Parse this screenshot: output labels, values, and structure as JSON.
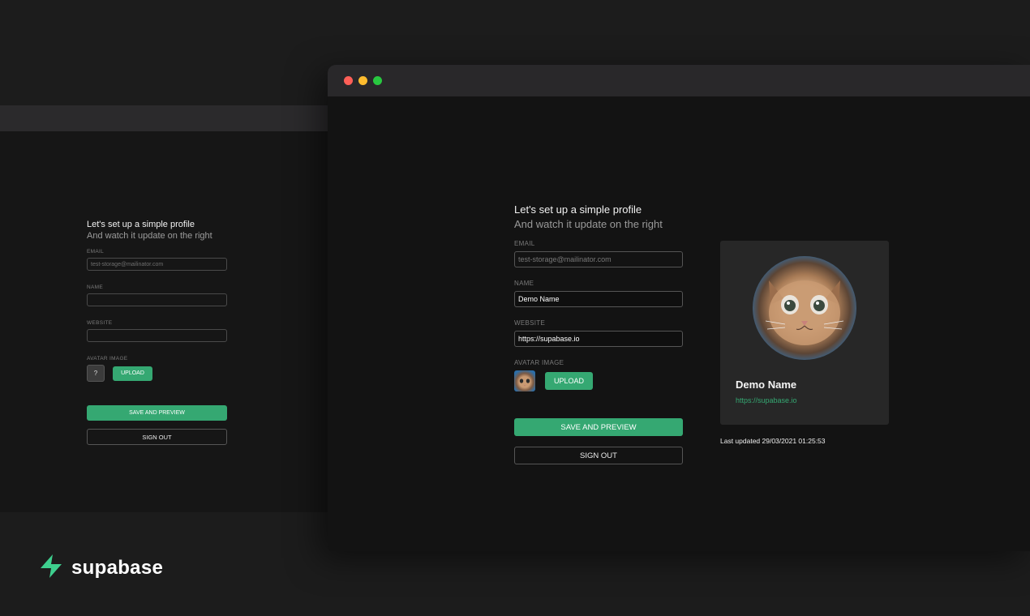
{
  "back_form": {
    "title": "Let's set up a simple profile",
    "subtitle": "And watch it update on the right",
    "email_label": "EMAIL",
    "email_value": "test-storage@mailinator.com",
    "name_label": "NAME",
    "name_value": "",
    "website_label": "WEBSITE",
    "website_value": "",
    "avatar_label": "AVATAR IMAGE",
    "avatar_placeholder": "?",
    "upload_label": "UPLOAD",
    "save_label": "SAVE AND PREVIEW",
    "signout_label": "SIGN OUT"
  },
  "front_form": {
    "title": "Let's set up a simple profile",
    "subtitle": "And watch it update on the right",
    "email_label": "EMAIL",
    "email_value": "test-storage@mailinator.com",
    "name_label": "NAME",
    "name_value": "Demo Name",
    "website_label": "WEBSITE",
    "website_value": "https://supabase.io",
    "avatar_label": "AVATAR IMAGE",
    "upload_label": "UPLOAD",
    "save_label": "SAVE AND PREVIEW",
    "signout_label": "SIGN OUT"
  },
  "preview_card": {
    "name": "Demo Name",
    "url": "https://supabase.io",
    "last_updated": "Last updated 29/03/2021 01:25:53"
  },
  "brand": {
    "name": "supabase",
    "accent": "#3ecf8e"
  },
  "colors": {
    "button_green": "#35a872",
    "window_bg": "#131313",
    "titlebar": "#29282a"
  }
}
